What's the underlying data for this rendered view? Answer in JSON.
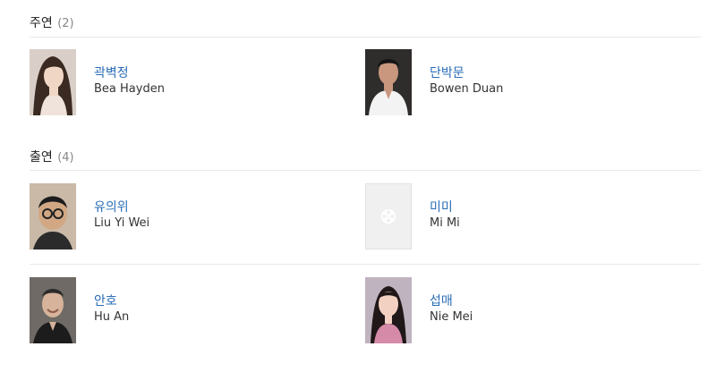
{
  "sections": {
    "main": {
      "title": "주연",
      "count": "(2)"
    },
    "supporting": {
      "title": "출연",
      "count": "(4)"
    }
  },
  "people": [
    {
      "name_ko": "곽벽정",
      "name_en": "Bea Hayden",
      "photo": "portrait-woman-long-hair"
    },
    {
      "name_ko": "단박문",
      "name_en": "Bowen Duan",
      "photo": "portrait-man-white-shirt"
    },
    {
      "name_ko": "유의위",
      "name_en": "Liu Yi Wei",
      "photo": "portrait-man-glasses"
    },
    {
      "name_ko": "미미",
      "name_en": "Mi Mi",
      "photo": "film-reel-icon"
    },
    {
      "name_ko": "안호",
      "name_en": "Hu An",
      "photo": "portrait-man-smiling"
    },
    {
      "name_ko": "섭매",
      "name_en": "Nie Mei",
      "photo": "portrait-woman-dark-hair"
    }
  ],
  "colors": {
    "link": "#2a6db6",
    "text": "#333333",
    "muted": "#888888",
    "divider": "#e9e9e9"
  }
}
